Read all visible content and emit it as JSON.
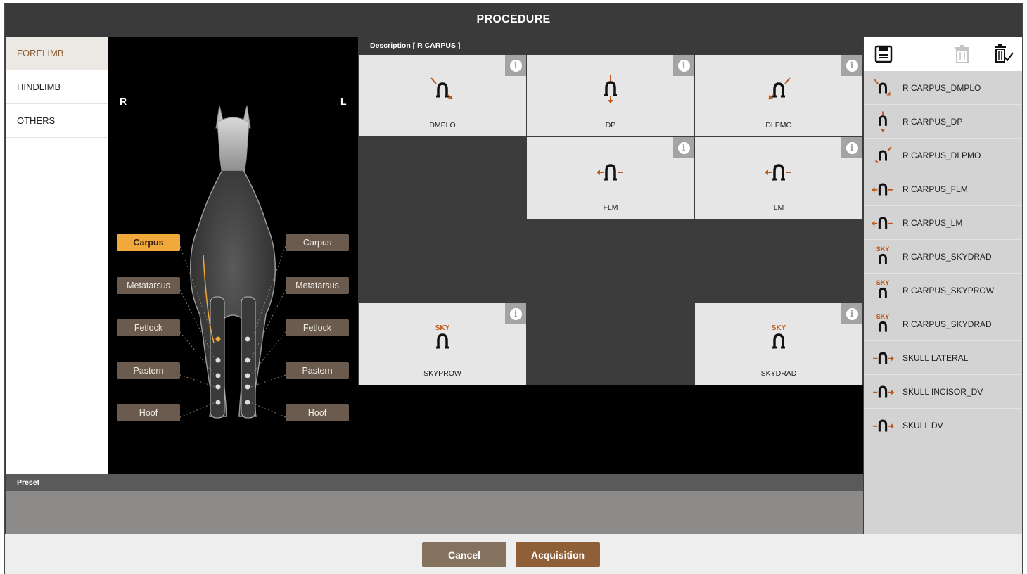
{
  "window": {
    "title": "PROCEDURE"
  },
  "categories": [
    {
      "label": "FORELIMB",
      "active": true
    },
    {
      "label": "HINDLIMB",
      "active": false
    },
    {
      "label": "OTHERS",
      "active": false
    }
  ],
  "horse": {
    "right_label": "R",
    "left_label": "L",
    "parts_right": [
      "Carpus",
      "Metatarsus",
      "Fetlock",
      "Pastern",
      "Hoof"
    ],
    "parts_left": [
      "Carpus",
      "Metatarsus",
      "Fetlock",
      "Pastern",
      "Hoof"
    ],
    "selected_part": "Carpus"
  },
  "description": {
    "text": "Description [  R CARPUS  ]"
  },
  "grid": {
    "cells": [
      {
        "caption": "DMPLO",
        "icon": "horseshoe-arrow-dmplo-icon"
      },
      {
        "caption": "DP",
        "icon": "horseshoe-arrow-dp-icon"
      },
      {
        "caption": "DLPMO",
        "icon": "horseshoe-arrow-dlpmo-icon"
      },
      {
        "caption": "FLM",
        "icon": "horseshoe-arrow-flm-icon"
      },
      {
        "caption": "LM",
        "icon": "horseshoe-arrow-lm-icon"
      },
      {
        "caption": "SKYPROW",
        "icon": "horseshoe-sky-icon",
        "sky": "SKY"
      },
      {
        "caption": "SKYDRAD",
        "icon": "horseshoe-sky-icon",
        "sky": "SKY"
      }
    ]
  },
  "procedure_list": [
    {
      "label": "R CARPUS_DMPLO",
      "icon": "dmplo"
    },
    {
      "label": "R CARPUS_DP",
      "icon": "dp"
    },
    {
      "label": "R CARPUS_DLPMO",
      "icon": "dlpmo"
    },
    {
      "label": "R CARPUS_FLM",
      "icon": "flm"
    },
    {
      "label": "R CARPUS_LM",
      "icon": "lm"
    },
    {
      "label": "R CARPUS_SKYDRAD",
      "icon": "sky",
      "sky": "SKY"
    },
    {
      "label": "R CARPUS_SKYPROW",
      "icon": "sky",
      "sky": "SKY"
    },
    {
      "label": "R CARPUS_SKYDRAD",
      "icon": "sky",
      "sky": "SKY"
    },
    {
      "label": "SKULL LATERAL",
      "icon": "skull"
    },
    {
      "label": "SKULL INCISOR_DV",
      "icon": "skull"
    },
    {
      "label": "SKULL DV",
      "icon": "skull"
    }
  ],
  "preset": {
    "label": "Preset"
  },
  "footer": {
    "cancel": "Cancel",
    "acquisition": "Acquisition"
  },
  "colors": {
    "accent_brown": "#8f6037",
    "arrow_orange": "#c0581c",
    "selected_orange": "#f2a93b"
  }
}
